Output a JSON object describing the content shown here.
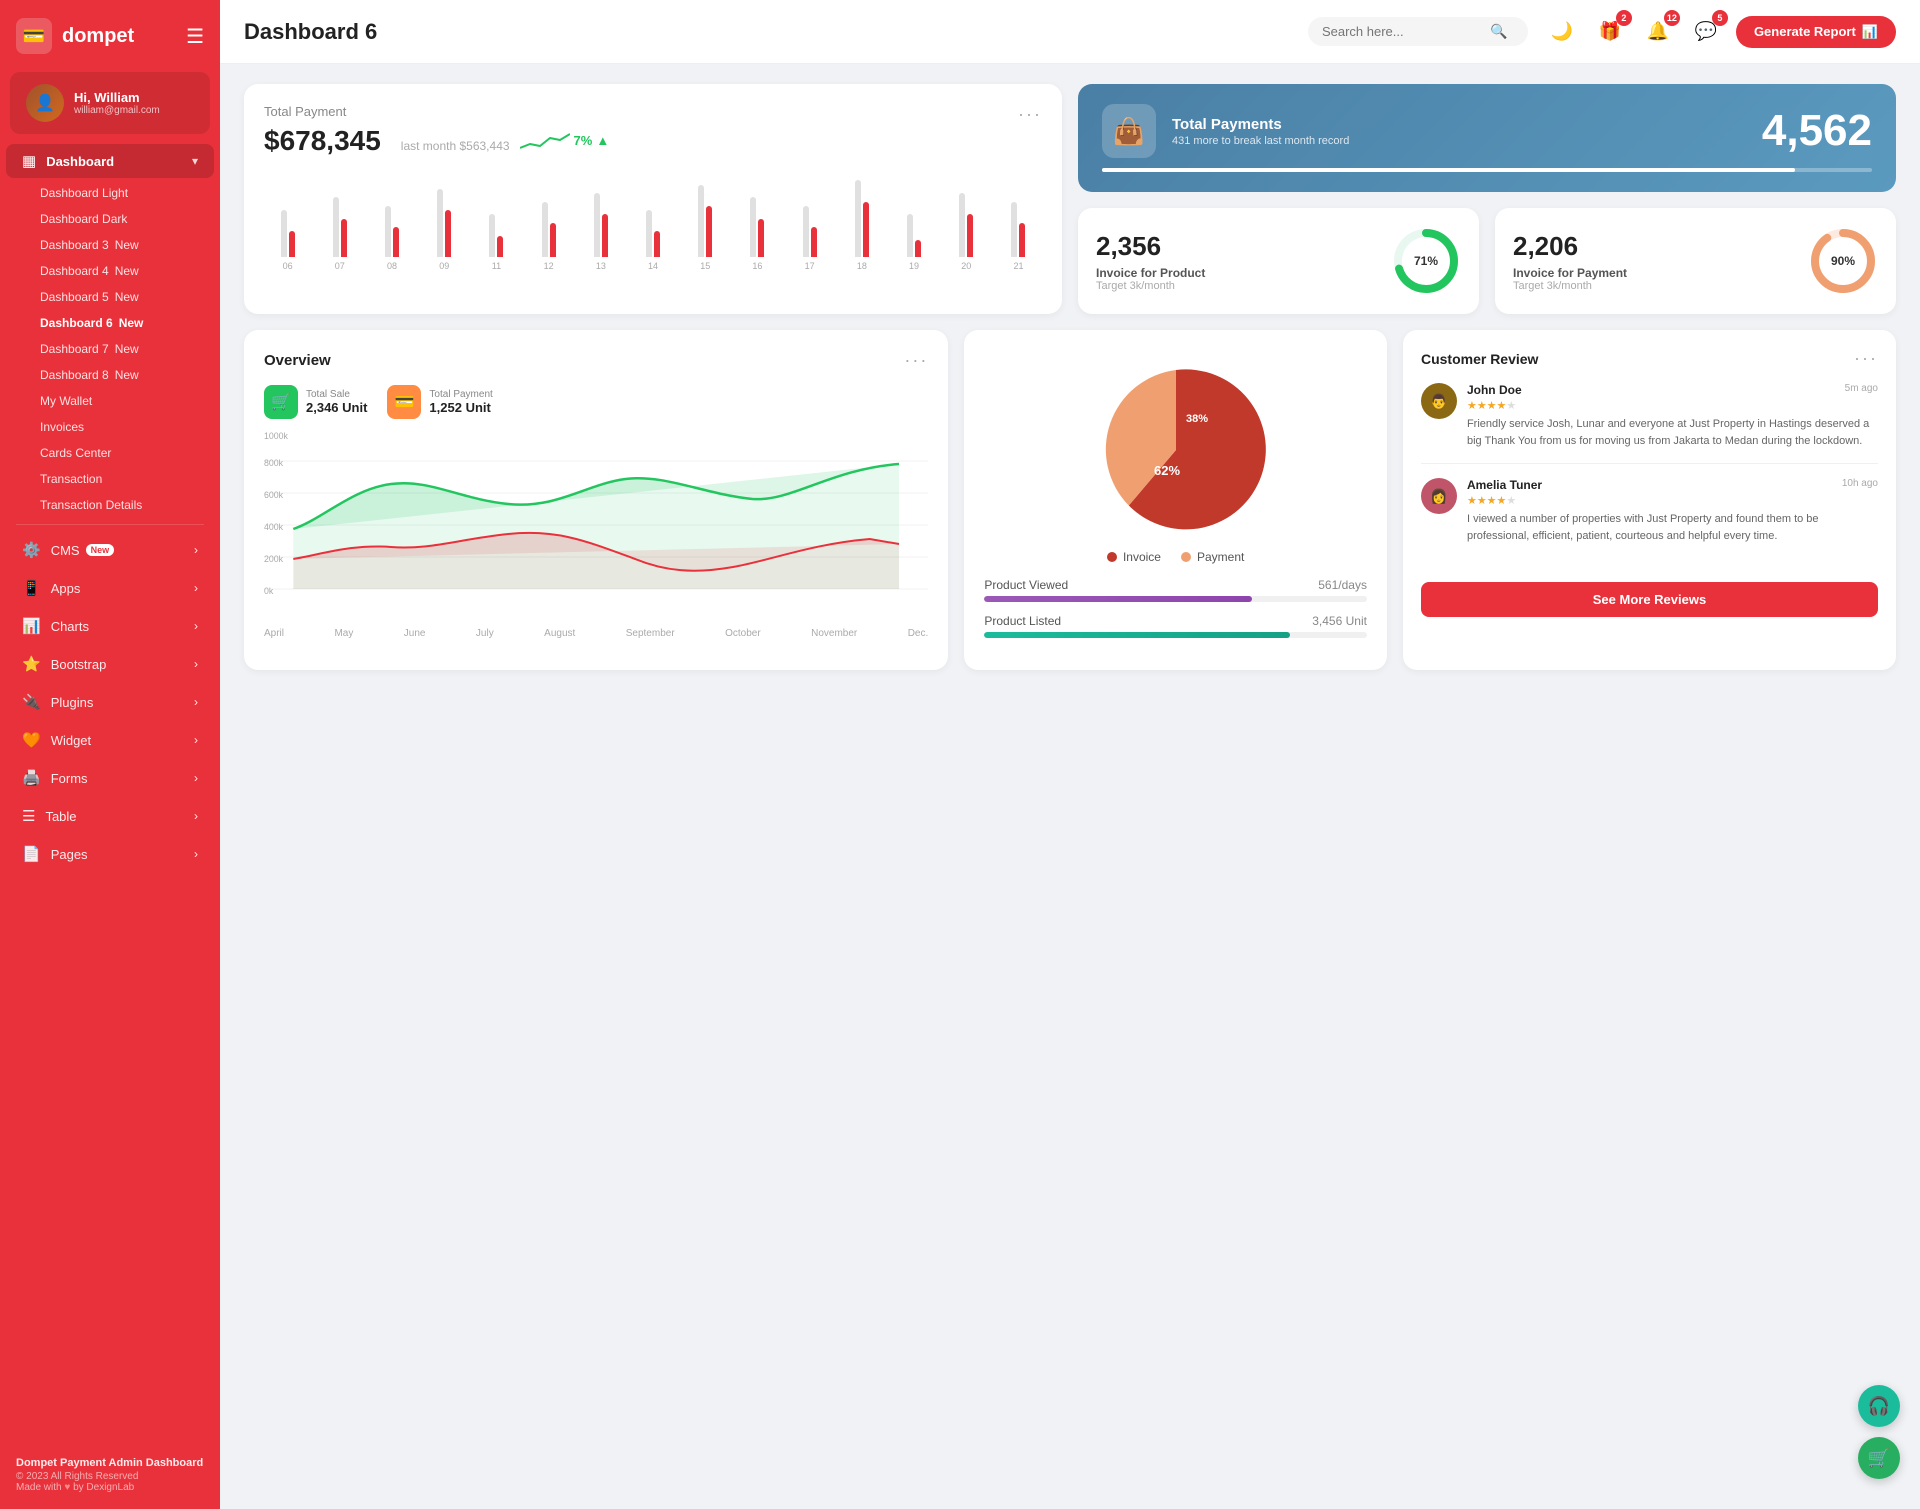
{
  "app": {
    "name": "dompet",
    "logo_icon": "💳"
  },
  "user": {
    "greeting": "Hi, William",
    "name": "William",
    "email": "william@gmail.com",
    "avatar_emoji": "👤"
  },
  "sidebar": {
    "dashboard_label": "Dashboard",
    "submenu": [
      {
        "label": "Dashboard Light",
        "badge": null,
        "active": false
      },
      {
        "label": "Dashboard Dark",
        "badge": null,
        "active": false
      },
      {
        "label": "Dashboard 3",
        "badge": "New",
        "active": false
      },
      {
        "label": "Dashboard 4",
        "badge": "New",
        "active": false
      },
      {
        "label": "Dashboard 5",
        "badge": "New",
        "active": false
      },
      {
        "label": "Dashboard 6",
        "badge": "New",
        "active": true
      },
      {
        "label": "Dashboard 7",
        "badge": "New",
        "active": false
      },
      {
        "label": "Dashboard 8",
        "badge": "New",
        "active": false
      },
      {
        "label": "My Wallet",
        "badge": null,
        "active": false
      },
      {
        "label": "Invoices",
        "badge": null,
        "active": false
      },
      {
        "label": "Cards Center",
        "badge": null,
        "active": false
      },
      {
        "label": "Transaction",
        "badge": null,
        "active": false
      },
      {
        "label": "Transaction Details",
        "badge": null,
        "active": false
      }
    ],
    "menu_items": [
      {
        "label": "CMS",
        "badge": "New",
        "icon": "⚙️",
        "has_arrow": true
      },
      {
        "label": "Apps",
        "badge": null,
        "icon": "📱",
        "has_arrow": true
      },
      {
        "label": "Charts",
        "badge": null,
        "icon": "📊",
        "has_arrow": true
      },
      {
        "label": "Bootstrap",
        "badge": null,
        "icon": "⭐",
        "has_arrow": true
      },
      {
        "label": "Plugins",
        "badge": null,
        "icon": "🔌",
        "has_arrow": true
      },
      {
        "label": "Widget",
        "badge": null,
        "icon": "🧡",
        "has_arrow": true
      },
      {
        "label": "Forms",
        "badge": null,
        "icon": "🖨️",
        "has_arrow": true
      },
      {
        "label": "Table",
        "badge": null,
        "icon": "☰",
        "has_arrow": true
      },
      {
        "label": "Pages",
        "badge": null,
        "icon": "📄",
        "has_arrow": true
      }
    ],
    "footer": {
      "title": "Dompet Payment Admin Dashboard",
      "copy": "© 2023 All Rights Reserved",
      "made_with": "Made with",
      "heart": "♥",
      "by": "by DexignLab"
    }
  },
  "topbar": {
    "title": "Dashboard 6",
    "search_placeholder": "Search here...",
    "icons": {
      "theme_icon": "🌙",
      "gift_badge": "2",
      "bell_badge": "12",
      "chat_badge": "5"
    },
    "generate_btn": "Generate Report"
  },
  "total_payment_card": {
    "title": "Total Payment",
    "amount": "$678,345",
    "last_month": "last month $563,443",
    "trend_pct": "7%",
    "trend_dir": "▲",
    "more": "···",
    "bars": [
      {
        "label": "06",
        "gray": 55,
        "red": 30
      },
      {
        "label": "07",
        "gray": 70,
        "red": 45
      },
      {
        "label": "08",
        "gray": 60,
        "red": 35
      },
      {
        "label": "09",
        "gray": 80,
        "red": 55
      },
      {
        "label": "11",
        "gray": 50,
        "red": 25
      },
      {
        "label": "12",
        "gray": 65,
        "red": 40
      },
      {
        "label": "13",
        "gray": 75,
        "red": 50
      },
      {
        "label": "14",
        "gray": 55,
        "red": 30
      },
      {
        "label": "15",
        "gray": 85,
        "red": 60
      },
      {
        "label": "16",
        "gray": 70,
        "red": 45
      },
      {
        "label": "17",
        "gray": 60,
        "red": 35
      },
      {
        "label": "18",
        "gray": 90,
        "red": 65
      },
      {
        "label": "19",
        "gray": 50,
        "red": 20
      },
      {
        "label": "20",
        "gray": 75,
        "red": 50
      },
      {
        "label": "21",
        "gray": 65,
        "red": 40
      }
    ]
  },
  "blue_card": {
    "icon": "👜",
    "title": "Total Payments",
    "sub": "431 more to break last month record",
    "number": "4,562",
    "progress": 90
  },
  "invoice_product": {
    "value": "2,356",
    "label": "Invoice for Product",
    "sub": "Target 3k/month",
    "pct": 71,
    "color": "#22c55e"
  },
  "invoice_payment": {
    "value": "2,206",
    "label": "Invoice for Payment",
    "sub": "Target 3k/month",
    "pct": 90,
    "color": "#f0a070"
  },
  "overview": {
    "title": "Overview",
    "more": "···",
    "total_sale_label": "Total Sale",
    "total_sale_value": "2,346 Unit",
    "total_payment_label": "Total Payment",
    "total_payment_value": "1,252 Unit",
    "x_labels": [
      "April",
      "May",
      "June",
      "July",
      "August",
      "September",
      "October",
      "November",
      "Dec."
    ],
    "y_labels": [
      "0k",
      "200k",
      "400k",
      "600k",
      "800k",
      "1000k"
    ]
  },
  "pie_chart": {
    "invoice_pct": 62,
    "payment_pct": 38,
    "invoice_label": "Invoice",
    "payment_label": "Payment",
    "invoice_color": "#c0392b",
    "payment_color": "#f0a070"
  },
  "product_stats": {
    "viewed_label": "Product Viewed",
    "viewed_value": "561/days",
    "viewed_fill": 70,
    "listed_label": "Product Listed",
    "listed_value": "3,456 Unit",
    "listed_fill": 80
  },
  "reviews": {
    "title": "Customer Review",
    "more": "···",
    "items": [
      {
        "name": "John Doe",
        "time": "5m ago",
        "stars": 4,
        "text": "Friendly service Josh, Lunar and everyone at Just Property in Hastings deserved a big Thank You from us for moving us from Jakarta to Medan during the lockdown.",
        "avatar_bg": "#8B6914",
        "avatar_emoji": "👨"
      },
      {
        "name": "Amelia Tuner",
        "time": "10h ago",
        "stars": 4,
        "text": "I viewed a number of properties with Just Property and found them to be professional, efficient, patient, courteous and helpful every time.",
        "avatar_bg": "#c0556a",
        "avatar_emoji": "👩"
      }
    ],
    "see_more_btn": "See More Reviews"
  }
}
